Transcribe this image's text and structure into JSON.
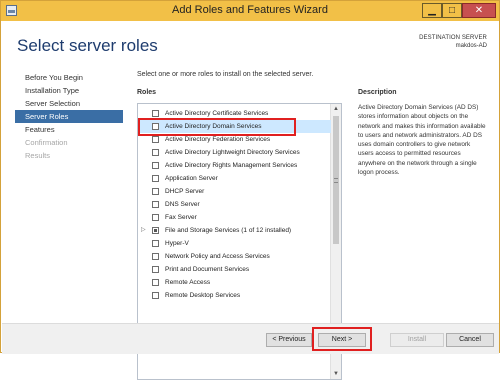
{
  "window": {
    "title": "Add Roles and Features Wizard"
  },
  "header": {
    "page_title": "Select server roles",
    "destination_label": "DESTINATION SERVER",
    "destination_value": "makdos-AD"
  },
  "nav": {
    "items": [
      {
        "label": "Before You Begin",
        "state": "normal"
      },
      {
        "label": "Installation Type",
        "state": "normal"
      },
      {
        "label": "Server Selection",
        "state": "normal"
      },
      {
        "label": "Server Roles",
        "state": "active"
      },
      {
        "label": "Features",
        "state": "normal"
      },
      {
        "label": "Confirmation",
        "state": "disabled"
      },
      {
        "label": "Results",
        "state": "disabled"
      }
    ]
  },
  "content": {
    "instruction": "Select one or more roles to install on the selected server.",
    "roles_header": "Roles",
    "roles": [
      {
        "label": "Active Directory Certificate Services",
        "checked": false
      },
      {
        "label": "Active Directory Domain Services",
        "checked": false,
        "selected": true
      },
      {
        "label": "Active Directory Federation Services",
        "checked": false
      },
      {
        "label": "Active Directory Lightweight Directory Services",
        "checked": false
      },
      {
        "label": "Active Directory Rights Management Services",
        "checked": false
      },
      {
        "label": "Application Server",
        "checked": false
      },
      {
        "label": "DHCP Server",
        "checked": false
      },
      {
        "label": "DNS Server",
        "checked": false
      },
      {
        "label": "Fax Server",
        "checked": false
      },
      {
        "label": "File and Storage Services (1 of 12 installed)",
        "checked": "partial",
        "expandable": true
      },
      {
        "label": "Hyper-V",
        "checked": false
      },
      {
        "label": "Network Policy and Access Services",
        "checked": false
      },
      {
        "label": "Print and Document Services",
        "checked": false
      },
      {
        "label": "Remote Access",
        "checked": false
      },
      {
        "label": "Remote Desktop Services",
        "checked": false
      }
    ],
    "description_header": "Description",
    "description_text": "Active Directory Domain Services (AD DS) stores information about objects on the network and makes this information available to users and network administrators. AD DS uses domain controllers to give network users access to permitted resources anywhere on the network through a single logon process."
  },
  "footer": {
    "previous": "< Previous",
    "next": "Next >",
    "install": "Install",
    "cancel": "Cancel"
  },
  "colors": {
    "accent": "#3a6ea5",
    "titlebar": "#f2c047",
    "highlight": "#e02020"
  }
}
